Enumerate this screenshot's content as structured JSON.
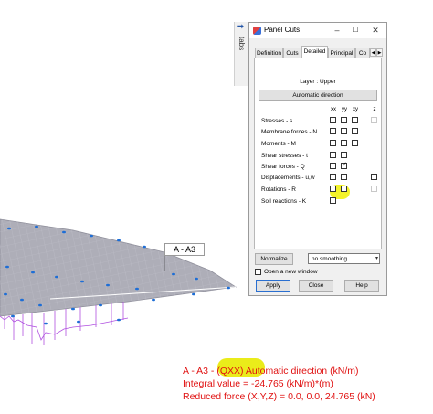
{
  "side_panel": {
    "arrow": "🡆",
    "label": "tabs"
  },
  "dialog": {
    "title": "Panel Cuts",
    "tabs": [
      {
        "label": "Definition",
        "active": false
      },
      {
        "label": "Cuts",
        "active": false
      },
      {
        "label": "Detailed",
        "active": true
      },
      {
        "label": "Principal",
        "active": false
      },
      {
        "label": "Co",
        "active": false
      }
    ],
    "layer_label": "Layer : Upper",
    "auto_direction_button": "Automatic direction",
    "columns": [
      "xx",
      "yy",
      "xy",
      "z"
    ],
    "rows": [
      {
        "label": "Stresses - s",
        "checks": [
          "off",
          "off",
          "off",
          "disabled"
        ]
      },
      {
        "label": "Membrane forces - N",
        "checks": [
          "off",
          "off",
          "off",
          "none"
        ]
      },
      {
        "label": "Moments - M",
        "checks": [
          "off",
          "off",
          "off",
          "none"
        ]
      },
      {
        "label": "Shear stresses - t",
        "checks": [
          "off",
          "off",
          "none",
          "none"
        ]
      },
      {
        "label": "Shear forces - Q",
        "checks": [
          "off",
          "on",
          "none",
          "none"
        ]
      },
      {
        "label": "Displacements - u,w",
        "checks": [
          "off",
          "off",
          "none",
          "off"
        ]
      },
      {
        "label": "Rotations - R",
        "checks": [
          "off",
          "off",
          "none",
          "disabled"
        ]
      },
      {
        "label": "Soil reactions - K",
        "checks": [
          "off",
          "none",
          "none",
          "none"
        ]
      }
    ],
    "normalize_button": "Normalize",
    "smoothing_value": "no smoothing",
    "new_window_label": "Open a new window",
    "apply_button": "Apply",
    "close_button": "Close",
    "help_button": "Help"
  },
  "viewport": {
    "cut_label": "A - A3",
    "result_lines": [
      "A - A3 - (QXX) Automatic direction (kN/m)",
      "Integral value = -24.765 (kN/m)*(m)",
      "Reduced force (X,Y,Z) = 0.0, 0.0, 24.765 (kN)"
    ],
    "result_color": "#e01010",
    "mesh_color": "#a8a8b4",
    "diagram_color": "#b050e0",
    "support_color": "#1e6ed6"
  }
}
